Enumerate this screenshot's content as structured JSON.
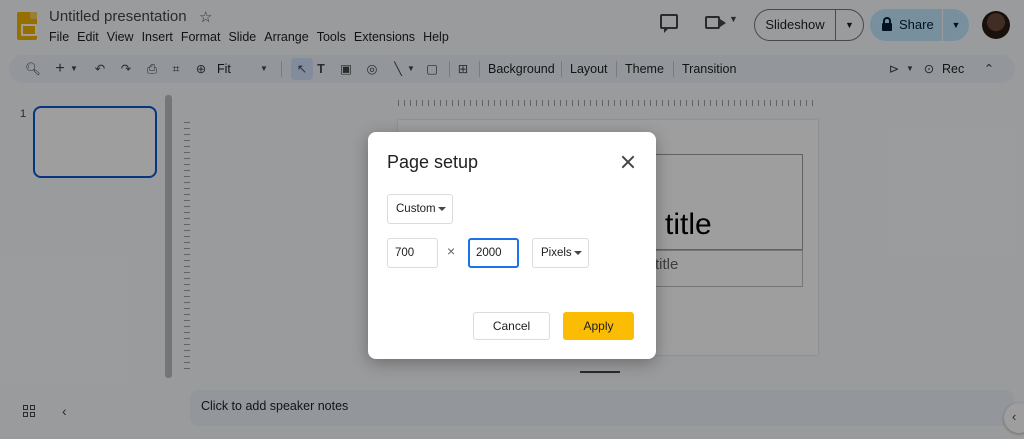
{
  "app": {
    "doc_title": "Untitled presentation",
    "menu": [
      "File",
      "Edit",
      "View",
      "Insert",
      "Format",
      "Slide",
      "Arrange",
      "Tools",
      "Extensions",
      "Help"
    ],
    "slideshow_label": "Slideshow",
    "share_label": "Share"
  },
  "toolbar": {
    "zoom_value": "Fit",
    "background_label": "Background",
    "layout_label": "Layout",
    "theme_label": "Theme",
    "transition_label": "Transition",
    "rec_label": "Rec",
    "icons": [
      "search-icon",
      "add-icon",
      "undo-icon",
      "redo-icon",
      "print-icon",
      "paint-format-icon",
      "zoom-icon",
      "select-icon",
      "text-box-icon",
      "image-icon",
      "shape-icon",
      "line-icon",
      "video-icon",
      "comment-add-icon",
      "pointer-icon",
      "record-icon",
      "collapse-icon"
    ]
  },
  "filmstrip": {
    "slide_number": "1"
  },
  "canvas": {
    "title_placeholder": "title",
    "subtitle_placeholder": "title",
    "speaker_notes_placeholder": "Click to add speaker notes"
  },
  "dialog": {
    "title": "Page setup",
    "preset_value": "Custom",
    "width_value": "700",
    "height_value": "2000",
    "times_symbol": "×",
    "unit_value": "Pixels",
    "cancel_label": "Cancel",
    "apply_label": "Apply",
    "apply_color": "#fbbc04"
  }
}
